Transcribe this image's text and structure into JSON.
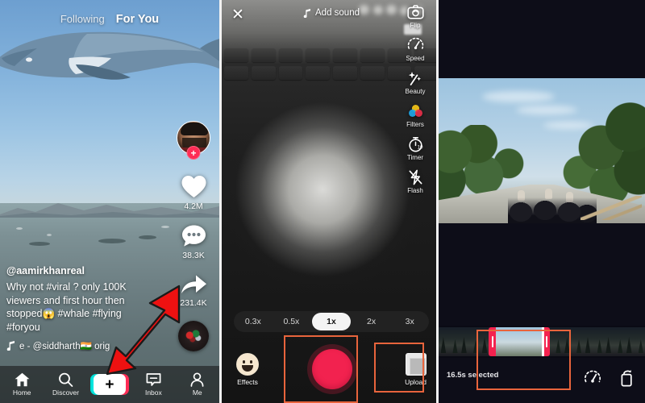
{
  "feed": {
    "tabs": {
      "following": "Following",
      "for_you": "For You"
    },
    "author": "@aamirkhanreal",
    "caption": "Why not #viral ? only 100K viewers and first hour then stopped😱 #whale #flying #foryou",
    "music": "e - @siddharth🇮🇳   orig",
    "music_icon": "music-note-icon",
    "actions": {
      "like_count": "4.2M",
      "comment_count": "38.3K",
      "share_count": "231.4K",
      "like_icon": "heart-icon",
      "comment_icon": "comment-icon",
      "share_icon": "share-arrow-icon",
      "follow_badge": "+",
      "disc_icon": "music-disc-icon"
    },
    "nav": [
      {
        "label": "Home",
        "icon": "home-icon"
      },
      {
        "label": "Discover",
        "icon": "search-icon"
      },
      {
        "label": "+",
        "icon": "plus-icon"
      },
      {
        "label": "Inbox",
        "icon": "inbox-icon"
      },
      {
        "label": "Me",
        "icon": "person-icon"
      }
    ],
    "annotation": {
      "arrow": "red-arrow-pointing-to-plus-button",
      "color": "#ee1111"
    }
  },
  "camera": {
    "close_icon": "close-x-icon",
    "add_sound": "Add sound",
    "tools": [
      {
        "label": "Flip",
        "icon": "camera-flip-icon"
      },
      {
        "label": "Speed",
        "icon": "speedometer-icon"
      },
      {
        "label": "Beauty",
        "icon": "sparkle-wand-icon"
      },
      {
        "label": "Filters",
        "icon": "color-circles-icon"
      },
      {
        "label": "Timer",
        "icon": "timer-10-icon"
      },
      {
        "label": "Flash",
        "icon": "flash-off-icon"
      }
    ],
    "speeds": [
      "0.3x",
      "0.5x",
      "1x",
      "2x",
      "3x"
    ],
    "selected_speed": "1x",
    "effects_label": "Effects",
    "effects_icon": "smiley-face-icon",
    "record_label": "record-button",
    "record_color": "#f2224f",
    "upload_label": "Upload",
    "upload_icon": "gallery-thumb-icon",
    "highlight_color": "#e8643c"
  },
  "editor": {
    "selection_text": "16.5s selected",
    "tools": [
      {
        "label": "",
        "icon": "speed-dial-icon"
      },
      {
        "label": "",
        "icon": "rotate-icon"
      }
    ],
    "trim_handle_color": "#f4224f",
    "highlight_color": "#e8643c"
  }
}
